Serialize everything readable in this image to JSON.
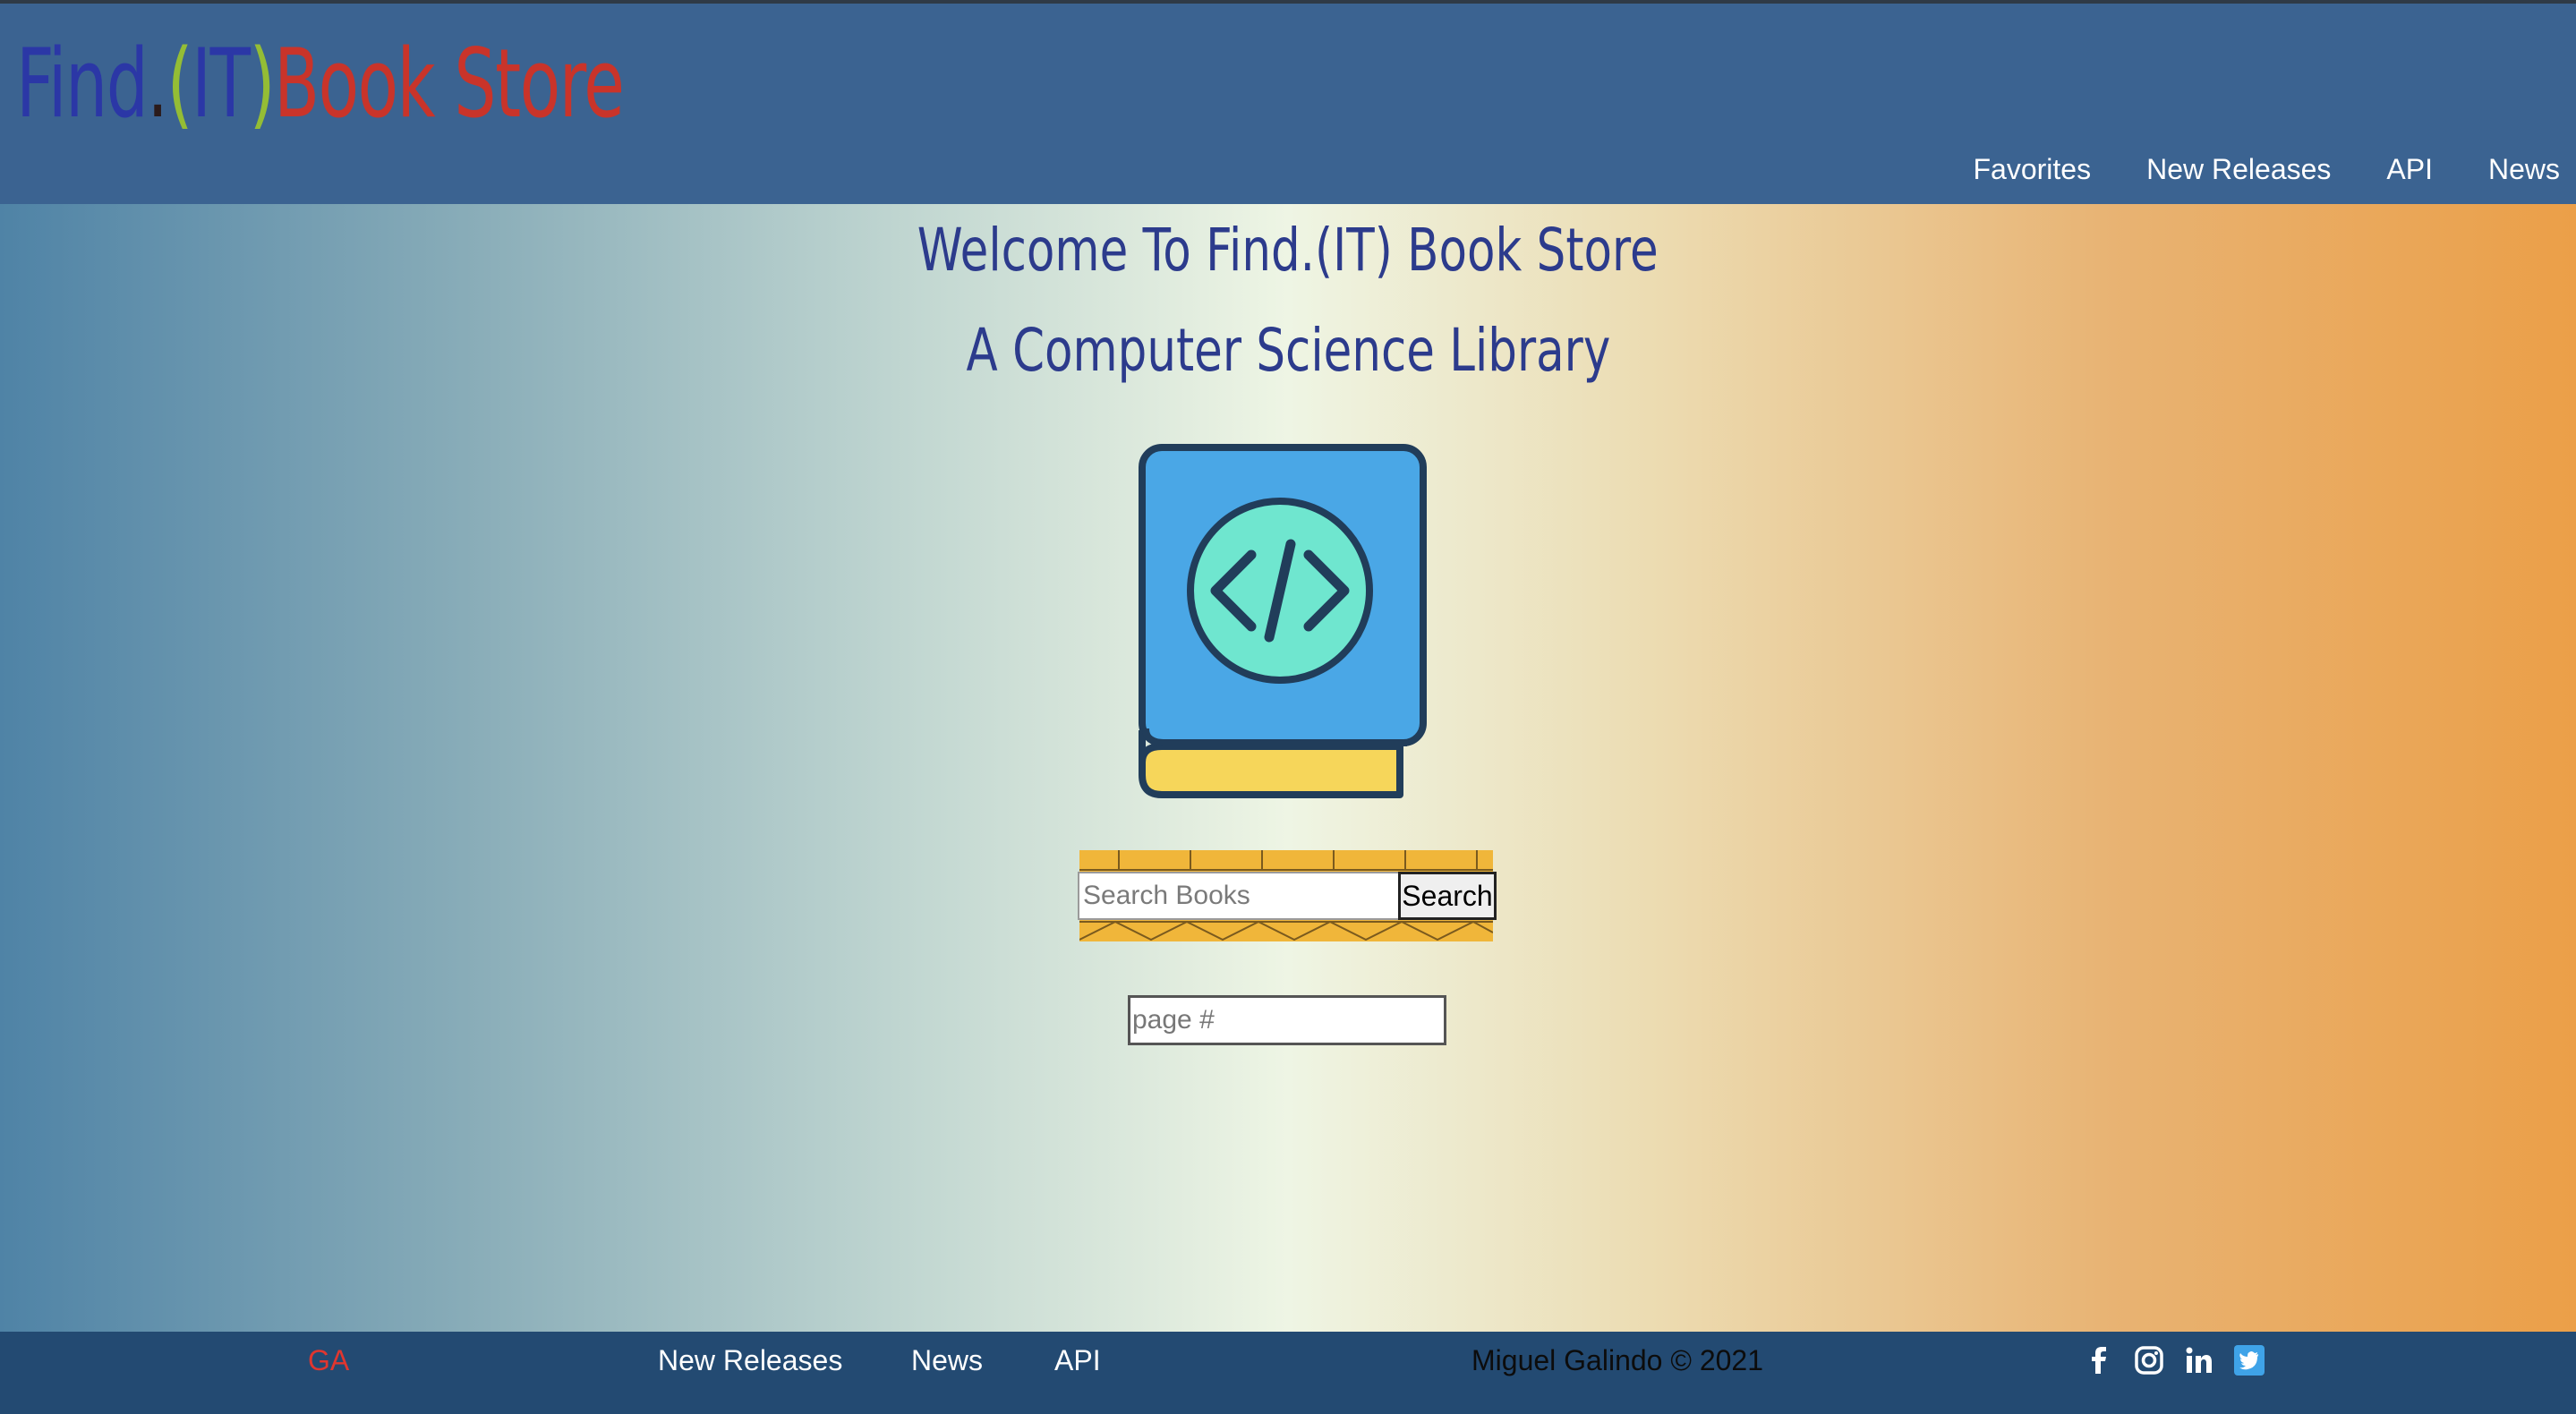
{
  "header": {
    "logo": {
      "part1": "Find",
      "part2": ".",
      "part3": "(",
      "part4": "IT",
      "part5": ")",
      "part6": "Book Store"
    },
    "nav": [
      {
        "label": "Favorites"
      },
      {
        "label": "New Releases"
      },
      {
        "label": "API"
      },
      {
        "label": "News"
      }
    ]
  },
  "main": {
    "welcome": "Welcome To Find.(IT) Book Store",
    "subtitle": "A Computer Science Library",
    "hero_icon": "code-book-icon",
    "search": {
      "placeholder": "Search Books",
      "value": "",
      "button_label": "Search"
    },
    "page_input": {
      "placeholder": "page #",
      "value": ""
    }
  },
  "footer": {
    "brand": "GA",
    "links": [
      {
        "label": "New Releases"
      },
      {
        "label": "News"
      },
      {
        "label": "API"
      }
    ],
    "copyright": "Miguel Galindo © 2021",
    "socials": [
      "facebook-icon",
      "instagram-icon",
      "linkedin-icon",
      "twitter-icon"
    ]
  },
  "colors": {
    "header_bg": "#3b6391",
    "footer_bg": "#234a72",
    "heading_text": "#2c3b8c",
    "logo_blue": "#2b37a6",
    "logo_green": "#94bd35",
    "logo_red": "#c9342a",
    "footer_brand": "#e0362f",
    "gradient_left": "#4f83a6",
    "gradient_center": "#eef5e4",
    "gradient_right": "#eb9f48"
  }
}
